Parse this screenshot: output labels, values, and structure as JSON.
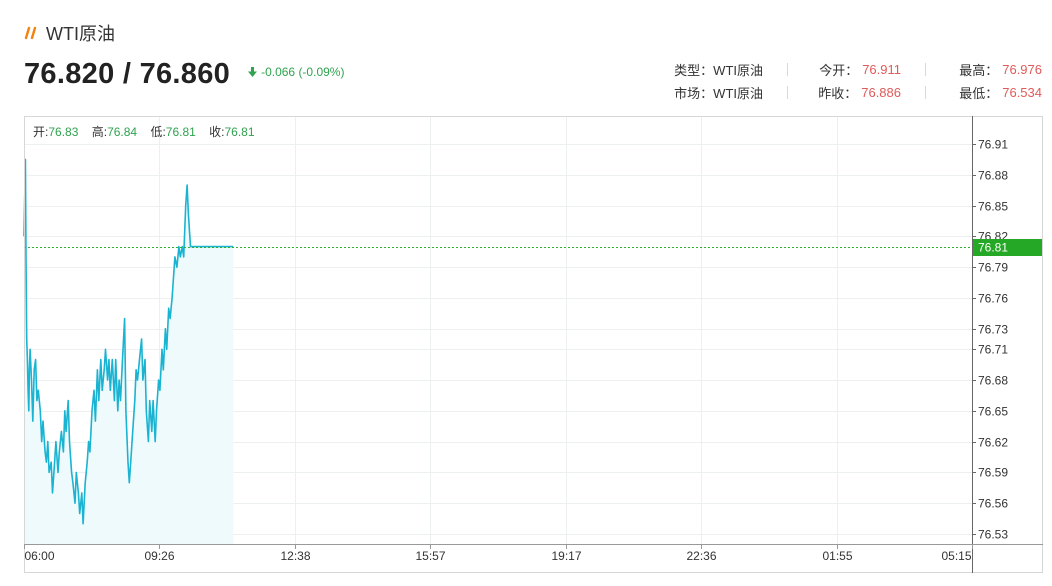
{
  "header": {
    "title": "WTI原油",
    "price": "76.820 / 76.860",
    "change": "-0.066 (-0.09%)",
    "accent_color": "#f2830c",
    "down_color": "#2fa34f",
    "title_icon": "double-slash-icon",
    "change_icon": "down-arrow-icon"
  },
  "info": {
    "type_label": "类型：",
    "type_value": "WTI原油",
    "market_label": "市场：",
    "market_value": "WTI原油",
    "open_label": "今开：",
    "open_value": "76.911",
    "prev_close_label": "昨收：",
    "prev_close_value": "76.886",
    "high_label": "最高：",
    "high_value": "76.976",
    "low_label": "最低：",
    "low_value": "76.534",
    "value_color": "#e05a5a"
  },
  "ohlc": {
    "open_label": "开:",
    "open_value": "76.83",
    "high_label": "高:",
    "high_value": "76.84",
    "low_label": "低:",
    "low_value": "76.81",
    "close_label": "收:",
    "close_value": "76.81"
  },
  "chart_data": {
    "type": "area",
    "title": "",
    "xlabel": "",
    "ylabel": "",
    "x_tick_labels": [
      "06:00",
      "09:26",
      "12:38",
      "15:57",
      "19:17",
      "22:36",
      "01:55",
      "05:15"
    ],
    "y_ticks": [
      "76.91",
      "76.88",
      "76.85",
      "76.82",
      "76.79",
      "76.76",
      "76.73",
      "76.71",
      "76.68",
      "76.65",
      "76.62",
      "76.59",
      "76.56",
      "76.53"
    ],
    "ylim": [
      76.515,
      76.94
    ],
    "x_range_minutes": [
      0,
      1395
    ],
    "current_price": "76.81",
    "current_price_value": 76.81,
    "line_color": "#1ab3d1",
    "fill_color": "#eefafc",
    "reference_line_color": "#2fb12f",
    "grid": true,
    "series": [
      {
        "x_minutes": [
          0,
          2,
          3,
          4,
          5,
          6,
          7,
          8,
          9,
          11,
          13,
          15,
          17,
          19,
          21,
          24,
          26,
          28,
          31,
          33,
          35,
          37,
          40,
          42,
          45,
          47,
          50,
          52,
          55,
          58,
          60,
          62,
          65,
          67,
          70,
          72,
          75,
          77,
          80,
          82,
          85,
          87,
          90,
          93,
          95,
          97,
          100,
          103,
          105,
          108,
          110,
          113,
          115,
          118,
          120,
          123,
          125,
          127,
          130,
          133,
          135,
          138,
          140,
          142,
          145,
          148,
          150,
          153,
          155,
          157,
          160,
          163,
          165,
          167,
          170,
          173,
          175,
          178,
          180,
          183,
          185,
          188,
          190,
          193,
          195,
          198,
          200,
          203,
          205,
          208,
          210,
          213,
          215,
          218,
          220,
          222,
          225,
          228,
          230,
          233,
          235,
          238,
          240,
          242,
          245,
          248,
          250,
          253,
          255,
          258,
          260,
          263,
          265,
          268,
          270,
          273,
          275,
          278,
          280,
          283,
          285,
          288,
          290,
          293,
          295,
          298,
          300,
          302,
          305,
          308
        ],
        "y": [
          76.82,
          76.895,
          76.8,
          76.72,
          76.7,
          76.67,
          76.65,
          76.69,
          76.71,
          76.68,
          76.64,
          76.69,
          76.7,
          76.66,
          76.67,
          76.65,
          76.62,
          76.64,
          76.61,
          76.6,
          76.62,
          76.59,
          76.6,
          76.57,
          76.6,
          76.62,
          76.59,
          76.61,
          76.63,
          76.61,
          76.65,
          76.63,
          76.66,
          76.62,
          76.59,
          76.58,
          76.56,
          76.59,
          76.57,
          76.55,
          76.57,
          76.54,
          76.58,
          76.6,
          76.62,
          76.61,
          76.65,
          76.67,
          76.64,
          76.69,
          76.66,
          76.7,
          76.67,
          76.69,
          76.71,
          76.68,
          76.7,
          76.67,
          76.7,
          76.66,
          76.7,
          76.65,
          76.68,
          76.66,
          76.7,
          76.74,
          76.65,
          76.6,
          76.58,
          76.6,
          76.63,
          76.66,
          76.69,
          76.68,
          76.7,
          76.72,
          76.68,
          76.7,
          76.65,
          76.62,
          76.66,
          76.63,
          76.66,
          76.62,
          76.65,
          76.68,
          76.67,
          76.71,
          76.69,
          76.73,
          76.71,
          76.75,
          76.74,
          76.76,
          76.78,
          76.8,
          76.79,
          76.81,
          76.8,
          76.81,
          76.8,
          76.85,
          76.87,
          76.84,
          76.81,
          76.81,
          76.81,
          76.81,
          76.81,
          76.81,
          76.81,
          76.81,
          76.81,
          76.81,
          76.81,
          76.81,
          76.81,
          76.81,
          76.81,
          76.81,
          76.81,
          76.81,
          76.81,
          76.81,
          76.81,
          76.81,
          76.81,
          76.81,
          76.81,
          76.81
        ]
      }
    ]
  }
}
